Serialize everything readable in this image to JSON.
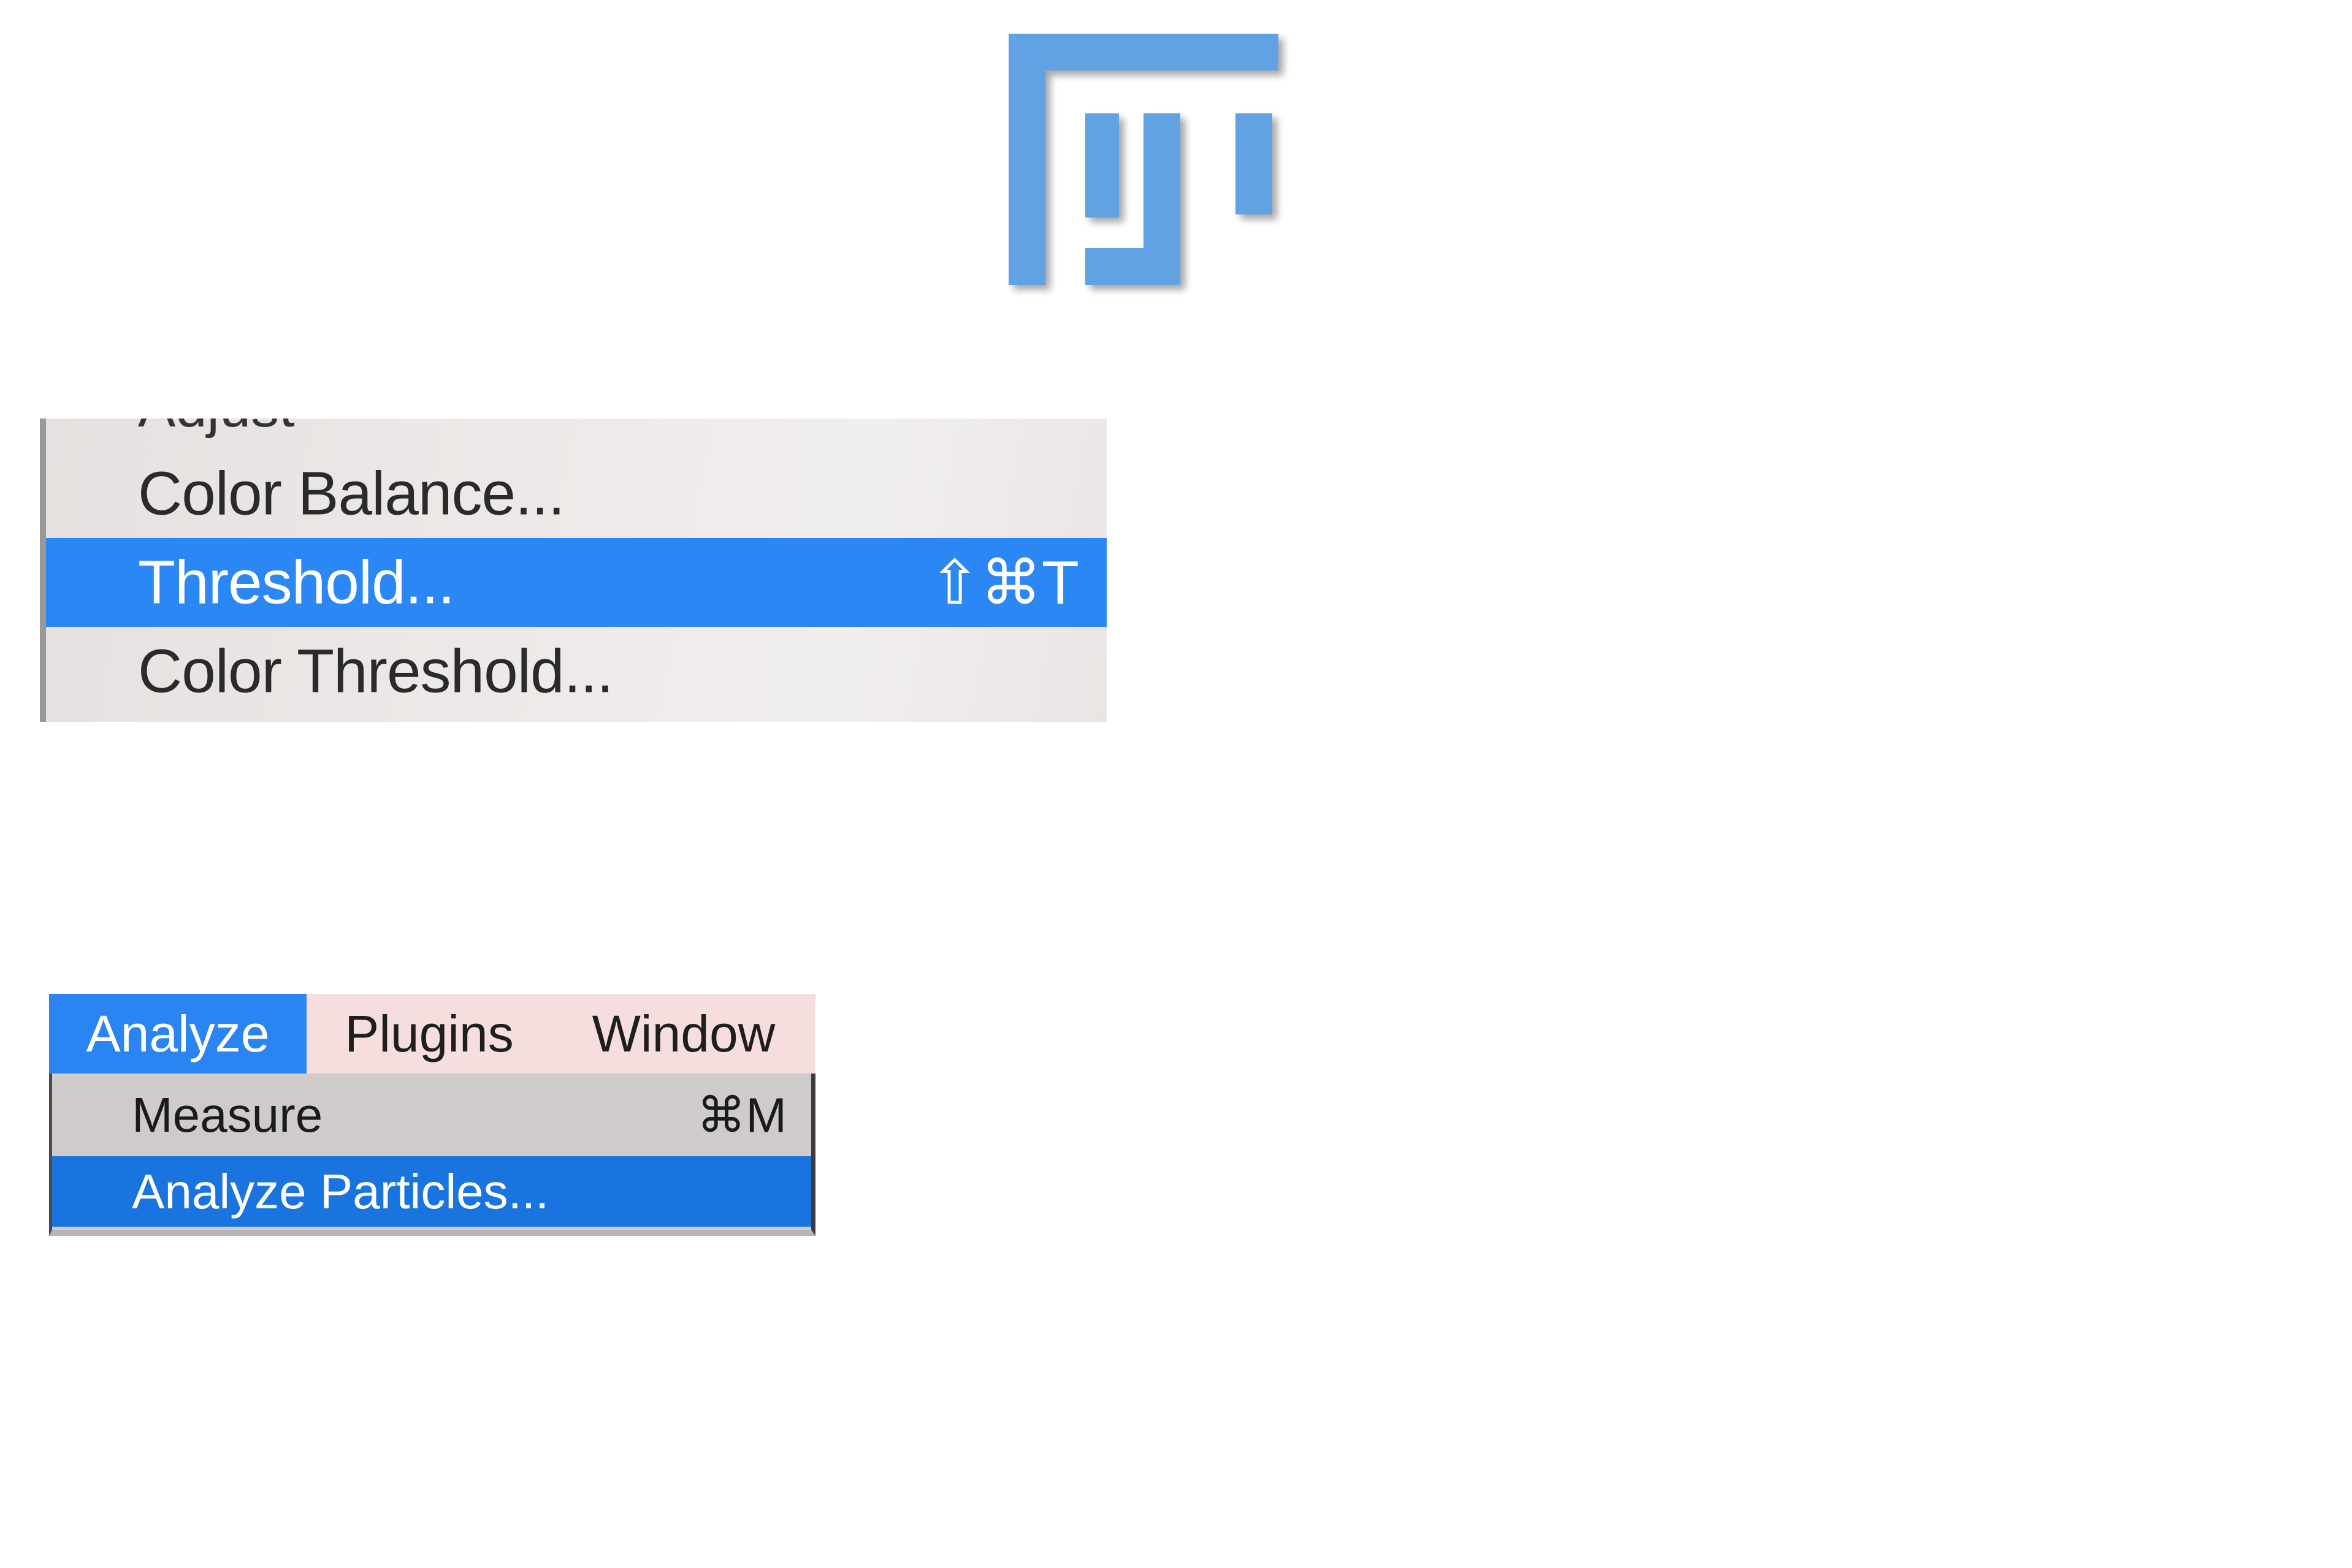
{
  "logo": {
    "icon": "fiji-logo-icon",
    "color": "#62a2e2"
  },
  "image_menu": {
    "cutoff_item": "Adjust",
    "items": [
      {
        "label": "Color Balance...",
        "shortcut": "",
        "highlighted": false
      },
      {
        "label": "Threshold...",
        "shortcut": "⇧⌘T",
        "highlighted": true
      },
      {
        "label": "Color Threshold...",
        "shortcut": "",
        "highlighted": false
      }
    ],
    "highlight_color": "#2b87f4"
  },
  "analyze_menu": {
    "menubar": [
      {
        "label": "Analyze",
        "active": true
      },
      {
        "label": "Plugins",
        "active": false
      },
      {
        "label": "Window",
        "active": false
      }
    ],
    "items": [
      {
        "label": "Measure",
        "shortcut": "⌘M",
        "highlighted": false
      },
      {
        "label": "Analyze Particles...",
        "shortcut": "",
        "highlighted": true
      }
    ],
    "highlight_color": "#1a74df",
    "menubar_color": "#f6dede"
  }
}
